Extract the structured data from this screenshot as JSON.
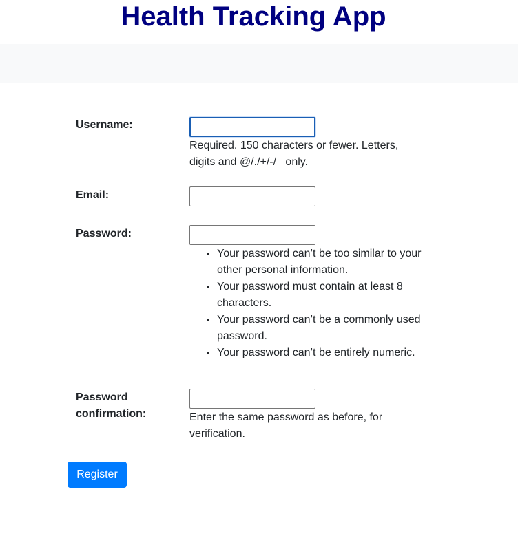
{
  "header": {
    "title": "Health Tracking App"
  },
  "colors": {
    "title": "#000080",
    "navbar_bg": "#f8f9fa",
    "button_bg": "#007bff",
    "focus_border": "#1a5fb4"
  },
  "form": {
    "username": {
      "label": "Username:",
      "value": "",
      "help": "Required. 150 characters or fewer. Letters, digits and @/./+/-/_ only."
    },
    "email": {
      "label": "Email:",
      "value": ""
    },
    "password": {
      "label": "Password:",
      "value": "",
      "rules": [
        "Your password can’t be too similar to your other personal information.",
        "Your password must contain at least 8 characters.",
        "Your password can’t be a commonly used password.",
        "Your password can’t be entirely numeric."
      ]
    },
    "password_confirmation": {
      "label": "Password confirmation:",
      "value": "",
      "help": "Enter the same password as before, for verification."
    },
    "submit_label": "Register"
  }
}
